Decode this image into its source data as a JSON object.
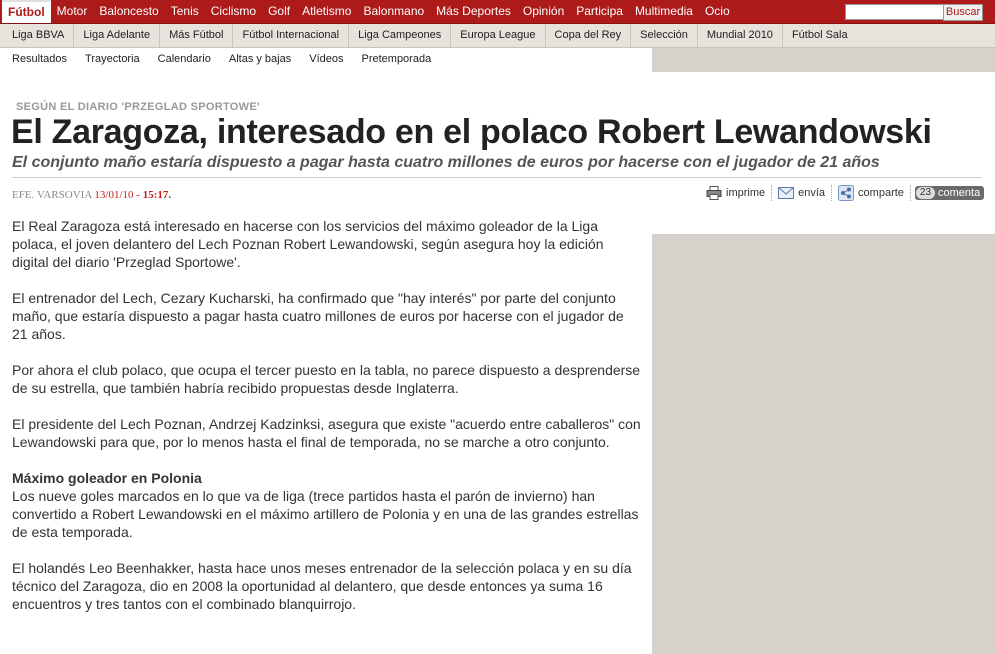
{
  "top_nav": {
    "items": [
      "Fútbol",
      "Motor",
      "Baloncesto",
      "Tenis",
      "Ciclismo",
      "Golf",
      "Atletismo",
      "Balonmano",
      "Más Deportes",
      "Opinión",
      "Participa",
      "Multimedia",
      "Ocio"
    ],
    "active": "Fútbol",
    "search_placeholder": "",
    "search_button": "Buscar",
    "bar_color": "#ac1a1a"
  },
  "sub_nav": {
    "items": [
      "Liga BBVA",
      "Liga Adelante",
      "Más Fútbol",
      "Fútbol Internacional",
      "Liga Campeones",
      "Europa League",
      "Copa del Rey",
      "Selección",
      "Mundial 2010",
      "Fútbol Sala"
    ]
  },
  "tertiary_nav": {
    "items": [
      "Resultados",
      "Trayectoria",
      "Calendario",
      "Altas y bajas",
      "Vídeos",
      "Pretemporada"
    ]
  },
  "article": {
    "kicker": "SEGÚN EL DIARIO 'PRZEGLAD SPORTOWE'",
    "headline": "El Zaragoza, interesado en el polaco Robert Lewandowski",
    "subtitle": "El conjunto maño estaría dispuesto a pagar hasta cuatro millones de euros por hacerse con el jugador de 21 años",
    "byline": {
      "agency": "EFE. VARSOVIA",
      "date": "13/01/10",
      "separator": " - ",
      "time": "15:17."
    },
    "tools": {
      "print": "imprime",
      "email": "envía",
      "share": "comparte",
      "comments_count": "23",
      "comments_label": "comenta"
    },
    "paragraphs_1": [
      "El Real Zaragoza está interesado en hacerse con los servicios del máximo goleador de la Liga polaca, el joven delantero del Lech Poznan Robert Lewandowski, según asegura hoy la edición digital del diario 'Przeglad Sportowe'.",
      "El entrenador del Lech, Cezary Kucharski, ha confirmado que \"hay interés\" por parte del conjunto maño, que estaría dispuesto a pagar hasta cuatro millones de euros por hacerse con el jugador de 21 años.",
      "Por ahora el club polaco, que ocupa el tercer puesto en la tabla, no parece dispuesto a desprenderse de su estrella, que también habría recibido propuestas desde Inglaterra.",
      "El presidente del Lech Poznan, Andrzej Kadzinksi, asegura que existe \"acuerdo entre caballeros\" con Lewandowski para que, por lo menos hasta el final de temporada, no se marche a otro conjunto."
    ],
    "section_heading": "Máximo goleador en Polonia",
    "paragraphs_2": [
      "Los nueve goles marcados en lo que va de liga (trece partidos hasta el parón de invierno) han convertido a Robert Lewandowski en el máximo artillero de Polonia y en una de las grandes estrellas de esta temporada.",
      "El holandés Leo Beenhakker, hasta hace unos meses entrenador de la selección polaca y en su día técnico del Zaragoza, dio en 2008 la oportunidad al delantero, que desde entonces ya suma 16 encuentros y tres tantos con el combinado blanquirrojo."
    ]
  }
}
